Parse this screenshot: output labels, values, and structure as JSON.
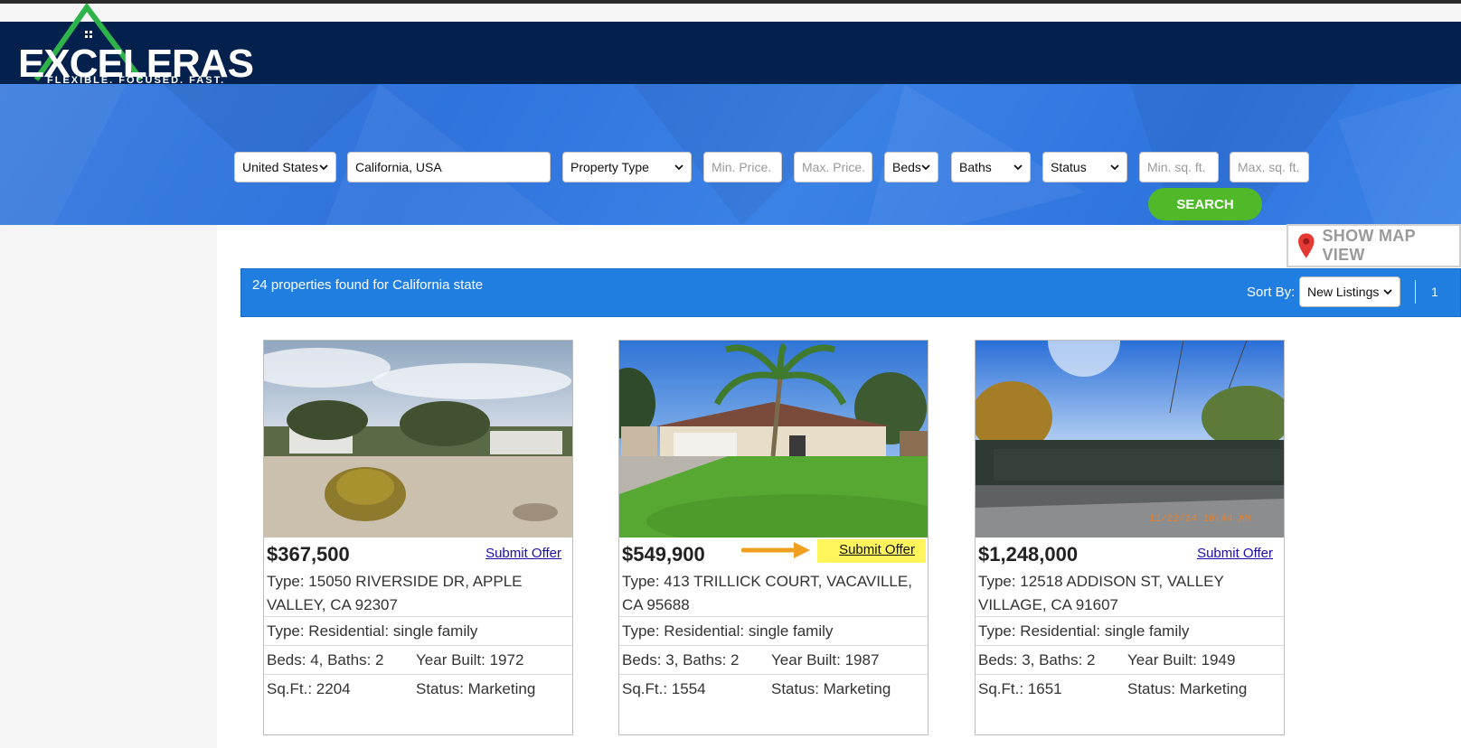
{
  "brand": {
    "name": "EXCELERAS",
    "tagline": "FLEXIBLE. FOCUSED. FAST.",
    "green": "#2db34a",
    "navy": "#04204d"
  },
  "search": {
    "country": "United States",
    "location_value": "California, USA",
    "property_type": "Property Type",
    "min_price_placeholder": "Min. Price.",
    "max_price_placeholder": "Max. Price.",
    "beds": "Beds",
    "baths": "Baths",
    "status": "Status",
    "min_sqft_placeholder": "Min. sq. ft.",
    "max_sqft_placeholder": "Max. sq. ft.",
    "search_label": "SEARCH"
  },
  "map_view": {
    "label": "SHOW MAP VIEW"
  },
  "results": {
    "summary": "24 properties found for California state",
    "sort_label": "Sort By:",
    "sort_value": "New Listings",
    "page": "1"
  },
  "listings": [
    {
      "price": "$367,500",
      "offer_label": "Submit Offer",
      "address": "Type: 15050 RIVERSIDE DR, APPLE VALLEY, CA 92307",
      "type": "Type: Residential: single family",
      "beds_baths": "Beds: 4, Baths: 2",
      "year_built": "Year Built: 1972",
      "sqft": "Sq.Ft.: 2204",
      "status": "Status: Marketing"
    },
    {
      "price": "$549,900",
      "offer_label": "Submit Offer",
      "address": "Type: 413 TRILLICK COURT, VACAVILLE, CA 95688",
      "type": "Type: Residential: single family",
      "beds_baths": "Beds: 3, Baths: 2",
      "year_built": "Year Built: 1987",
      "sqft": "Sq.Ft.: 1554",
      "status": "Status: Marketing"
    },
    {
      "price": "$1,248,000",
      "offer_label": "Submit Offer",
      "address": "Type: 12518 ADDISON ST, VALLEY VILLAGE, CA 91607",
      "type": "Type: Residential: single family",
      "beds_baths": "Beds: 3, Baths: 2",
      "year_built": "Year Built: 1949",
      "sqft": "Sq.Ft.: 1651",
      "status": "Status: Marketing",
      "photo_stamp": "11/22/24 10:44 AM"
    }
  ]
}
